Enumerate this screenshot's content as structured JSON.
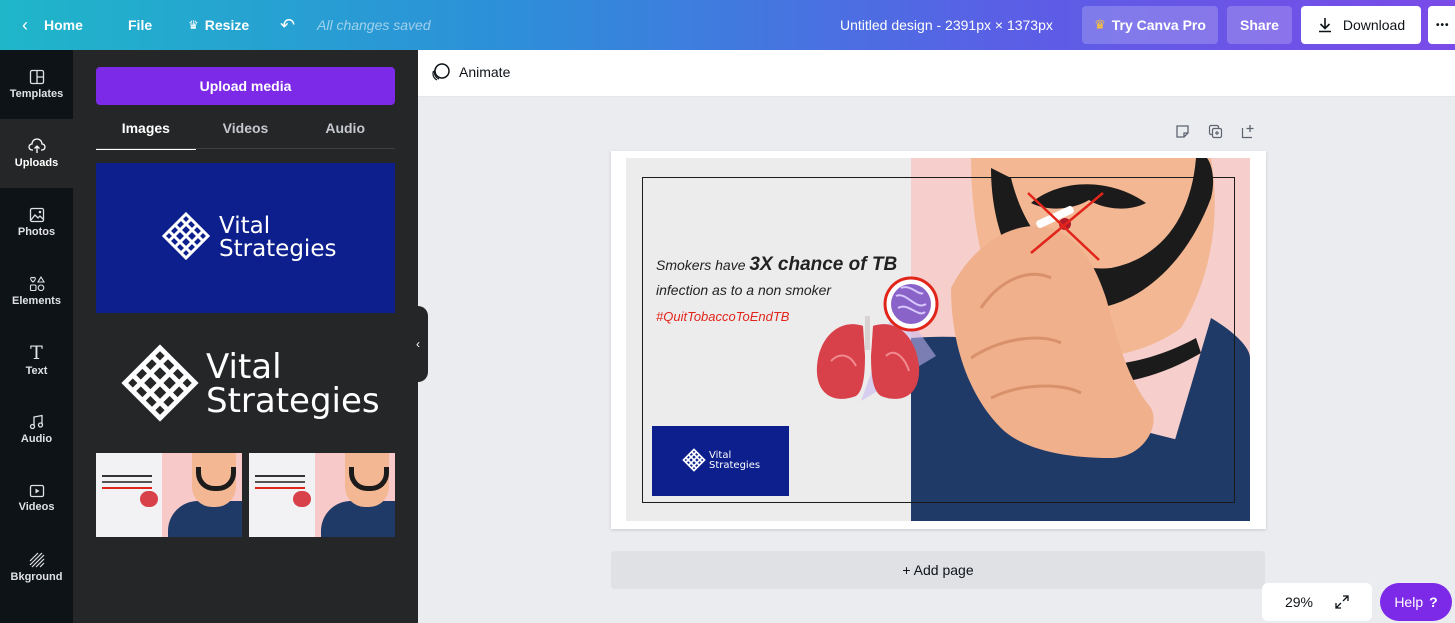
{
  "topbar": {
    "home_label": "Home",
    "file_label": "File",
    "resize_label": "Resize",
    "saved_status": "All changes saved",
    "design_title": "Untitled design - 2391px × 1373px",
    "try_pro_label": "Try Canva Pro",
    "share_label": "Share",
    "download_label": "Download",
    "more_label": "•••"
  },
  "rail": {
    "items": [
      {
        "label": "Templates",
        "icon": "templates-icon"
      },
      {
        "label": "Uploads",
        "icon": "cloud-upload-icon"
      },
      {
        "label": "Photos",
        "icon": "photo-icon"
      },
      {
        "label": "Elements",
        "icon": "shapes-icon"
      },
      {
        "label": "Text",
        "icon": "text-icon"
      },
      {
        "label": "Audio",
        "icon": "music-note-icon"
      },
      {
        "label": "Videos",
        "icon": "video-icon"
      },
      {
        "label": "Bkground",
        "icon": "background-icon"
      }
    ],
    "active": "Uploads"
  },
  "panel": {
    "upload_button": "Upload media",
    "tabs": [
      {
        "label": "Images",
        "active": true
      },
      {
        "label": "Videos",
        "active": false
      },
      {
        "label": "Audio",
        "active": false
      }
    ],
    "uploads": [
      {
        "type": "logo-on-blue",
        "logo_line1": "Vital",
        "logo_line2": "Strategies"
      },
      {
        "type": "logo-white",
        "logo_line1": "Vital",
        "logo_line2": "Strategies"
      },
      {
        "type": "design-thumbnail"
      },
      {
        "type": "design-thumbnail"
      }
    ]
  },
  "toolbar": {
    "animate_label": "Animate"
  },
  "design": {
    "line1_prefix": "Smokers have",
    "line1_bold": "3X chance of TB",
    "line2": "infection as to a non smoker",
    "hashtag": "#QuitTobaccoToEndTB",
    "logo_line1": "Vital",
    "logo_line2": "Strategies"
  },
  "canvas": {
    "add_page_label": "+ Add page",
    "zoom_level": "29%",
    "help_label": "Help",
    "help_mark": "?"
  },
  "colors": {
    "canva_purple": "#7d2ae8",
    "logo_navy": "#0c1f8c",
    "hashtag_red": "#e1251b",
    "pro_crown": "#ffc72c"
  }
}
